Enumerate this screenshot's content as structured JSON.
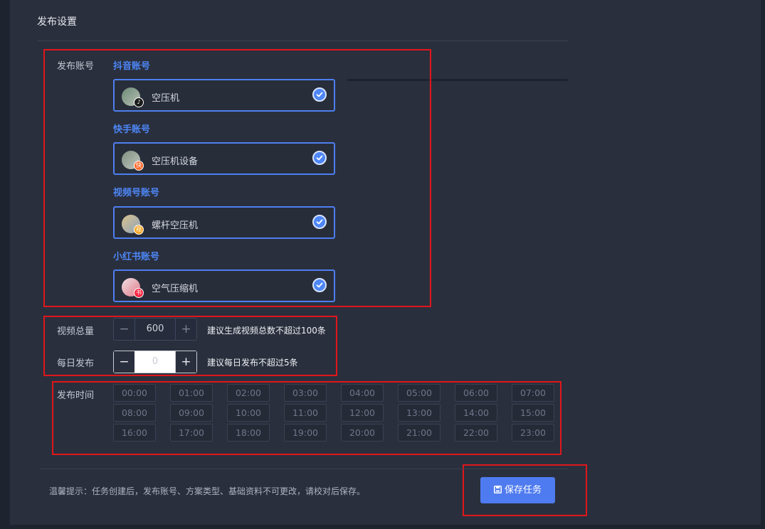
{
  "section_title": "发布设置",
  "accounts": {
    "label": "发布账号",
    "groups": [
      {
        "platform": "抖音账号",
        "account": "空压机",
        "badge": "♪",
        "badge_color": "#1b1b1b",
        "checked": true
      },
      {
        "platform": "快手账号",
        "account": "空压机设备",
        "badge": "快",
        "badge_color": "#ff6a2b",
        "checked": true
      },
      {
        "platform": "视频号账号",
        "account": "螺杆空压机",
        "badge": "视",
        "badge_color": "#f5a623",
        "checked": true
      },
      {
        "platform": "小红书账号",
        "account": "空气压缩机",
        "badge": "书",
        "badge_color": "#ff2442",
        "checked": true
      }
    ]
  },
  "video_total": {
    "label": "视频总量",
    "value": "600",
    "hint": "建议生成视频总数不超过100条"
  },
  "daily_publish": {
    "label": "每日发布",
    "placeholder": "0",
    "hint": "建议每日发布不超过5条"
  },
  "publish_time": {
    "label": "发布时间",
    "slots": [
      "00:00",
      "01:00",
      "02:00",
      "03:00",
      "04:00",
      "05:00",
      "06:00",
      "07:00",
      "08:00",
      "09:00",
      "10:00",
      "11:00",
      "12:00",
      "13:00",
      "14:00",
      "15:00",
      "16:00",
      "17:00",
      "18:00",
      "19:00",
      "20:00",
      "21:00",
      "22:00",
      "23:00"
    ]
  },
  "footer": {
    "tip": "温馨提示：任务创建后，发布账号、方案类型、基础资料不可更改，请校对后保存。",
    "save_label": "保存任务"
  },
  "colors": {
    "accent": "#4d86f5",
    "highlight_box": "#e0161b",
    "panel": "#2a2f3d"
  }
}
